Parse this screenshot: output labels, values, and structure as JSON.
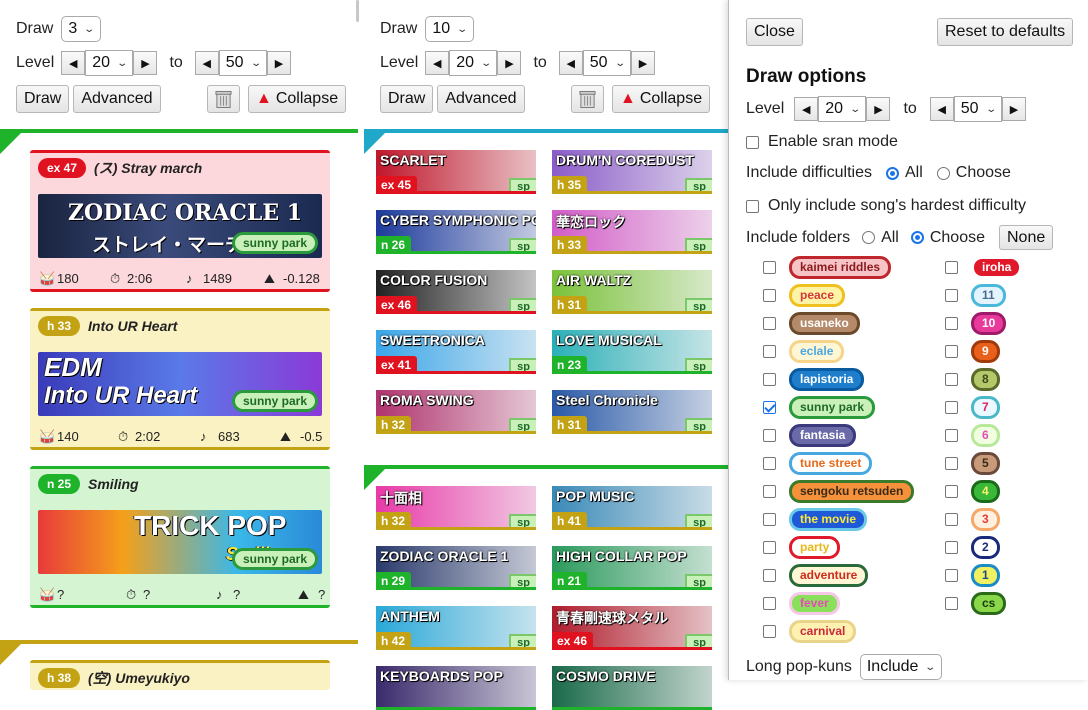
{
  "controls": {
    "draw_label": "Draw",
    "level_label": "Level",
    "to_label": "to",
    "draw_button": "Draw",
    "advanced_button": "Advanced",
    "collapse_button": "Collapse",
    "left_arrow": "◀",
    "right_arrow": "▶",
    "collapse_glyph": "▲"
  },
  "column1": {
    "draw_count": "3",
    "level_min": "20",
    "level_max": "50"
  },
  "column2": {
    "draw_count": "10",
    "level_min": "20",
    "level_max": "50"
  },
  "cards": [
    {
      "level": "ex 47",
      "title": "(ス) Stray march",
      "banner_line1": "ZODIAC ORACLE 1",
      "banner_line2": "ストレイ・マーチ",
      "folder": "sunny park",
      "bpm": "180",
      "time": "2:06",
      "notes": "1489",
      "tilt": "-0.128",
      "accent": "#e0121f",
      "bg": "#fcd8dc"
    },
    {
      "level": "h 33",
      "title": "Into UR Heart",
      "banner_line1": "EDM",
      "banner_line2": "Into UR Heart",
      "folder": "sunny park",
      "bpm": "140",
      "time": "2:02",
      "notes": "683",
      "tilt": "-0.5",
      "accent": "#c3a313",
      "bg": "#fbf2c4"
    },
    {
      "level": "n 25",
      "title": "Smiling",
      "banner_line1": "TRICK POP",
      "banner_line2": "Smiling",
      "folder": "sunny park",
      "bpm": "?",
      "time": "?",
      "notes": "?",
      "tilt": "?",
      "accent": "#1fb32b",
      "bg": "#d5f5d2"
    },
    {
      "level": "h 38",
      "title": "(空) Umeyukiyo",
      "accent": "#c3a313",
      "bg": "#fbf2c4"
    }
  ],
  "tiles_top": [
    {
      "title": "SCARLET",
      "level": "ex 45",
      "tag": "sp",
      "color": "#c0172b"
    },
    {
      "title": "DRUM'N COREDUST",
      "level": "h 35",
      "tag": "sp",
      "color": "#8b5cc8"
    },
    {
      "title": "CYBER SYMPHONIC POP",
      "level": "n 26",
      "tag": "sp",
      "color": "#1c3a9c"
    },
    {
      "title": "華恋ロック",
      "level": "h 33",
      "tag": "sp",
      "color": "#d25cc8"
    },
    {
      "title": "COLOR FUSION",
      "level": "ex 46",
      "tag": "sp",
      "color": "#222"
    },
    {
      "title": "AIR WALTZ",
      "level": "h 31",
      "tag": "sp",
      "color": "#7ac23a"
    },
    {
      "title": "SWEETRONICA",
      "level": "ex 41",
      "tag": "sp",
      "color": "#3aa6e8"
    },
    {
      "title": "LOVE MUSICAL",
      "level": "n 23",
      "tag": "sp",
      "color": "#2bb0b8"
    },
    {
      "title": "ROMA SWING",
      "level": "h 32",
      "tag": "sp",
      "color": "#b0336e"
    },
    {
      "title": "Steel Chronicle",
      "level": "h 31",
      "tag": "sp",
      "color": "#2a5aa8"
    }
  ],
  "tiles_bottom": [
    {
      "title": "十面相",
      "level": "h 32",
      "tag": "sp",
      "color": "#e83aa8"
    },
    {
      "title": "POP MUSIC",
      "level": "h 41",
      "tag": "sp",
      "color": "#3a8ab8"
    },
    {
      "title": "ZODIAC ORACLE 1",
      "level": "n 29",
      "tag": "sp",
      "color": "#2a3a6c"
    },
    {
      "title": "HIGH COLLAR POP",
      "level": "n 21",
      "tag": "sp",
      "color": "#2a9a5c"
    },
    {
      "title": "ANTHEM",
      "level": "h 42",
      "tag": "sp",
      "color": "#2aa8d8"
    },
    {
      "title": "青春剛速球メタル",
      "level": "ex 46",
      "tag": "sp",
      "color": "#b01c2c"
    },
    {
      "title": "KEYBOARDS POP",
      "level": "",
      "tag": "",
      "color": "#3a2a6c"
    },
    {
      "title": "COSMO DRIVE",
      "level": "",
      "tag": "",
      "color": "#1a6a4a"
    }
  ],
  "panel": {
    "close_button": "Close",
    "reset_button": "Reset to defaults",
    "title": "Draw options",
    "level_label": "Level",
    "level_min": "20",
    "level_max": "50",
    "to_label": "to",
    "sran_label": "Enable sran mode",
    "include_difficulties_label": "Include difficulties",
    "all_label": "All",
    "choose_label": "Choose",
    "hardest_label": "Only include song's hardest difficulty",
    "include_folders_label": "Include folders",
    "none_button": "None",
    "long_popkuns_label": "Long pop-kuns",
    "long_popkuns_value": "Include",
    "folders_left": [
      {
        "name": "kaimei riddles",
        "checked": false,
        "bg": "#f6c3c6",
        "border": "#c0272d",
        "fg": "#8a1a1e"
      },
      {
        "name": "peace",
        "checked": false,
        "bg": "#fff4a6",
        "border": "#f0c020",
        "fg": "#d03a3a"
      },
      {
        "name": "usaneko",
        "checked": false,
        "bg": "#b48a6a",
        "border": "#6a4a2a",
        "fg": "#fff"
      },
      {
        "name": "eclale",
        "checked": false,
        "bg": "#fff6d6",
        "border": "#f6d48a",
        "fg": "#4aa8e0"
      },
      {
        "name": "lapistoria",
        "checked": false,
        "bg": "#1e7ecb",
        "border": "#0a5aa0",
        "fg": "#fff"
      },
      {
        "name": "sunny park",
        "checked": true,
        "bg": "#c9f0b9",
        "border": "#2a9a3c",
        "fg": "#1d6b24"
      },
      {
        "name": "fantasia",
        "checked": false,
        "bg": "#6a6aa8",
        "border": "#3a3a7c",
        "fg": "#fff"
      },
      {
        "name": "tune street",
        "checked": false,
        "bg": "#fff",
        "border": "#4aa8e0",
        "fg": "#e86a1a"
      },
      {
        "name": "sengoku retsuden",
        "checked": false,
        "bg": "#f4913a",
        "border": "#3a7a2a",
        "fg": "#3a2a1a"
      },
      {
        "name": "the movie",
        "checked": false,
        "bg": "#1e5ad8",
        "border": "#6ac8e8",
        "fg": "#ffe83a"
      },
      {
        "name": "party",
        "checked": false,
        "bg": "#fff",
        "border": "#e01a2a",
        "fg": "#e8b81a"
      },
      {
        "name": "adventure",
        "checked": false,
        "bg": "#fff6d6",
        "border": "#2a6a3a",
        "fg": "#d02a1a"
      },
      {
        "name": "fever",
        "checked": false,
        "bg": "#8ae05a",
        "border": "#f6c8e8",
        "fg": "#e84ab8"
      },
      {
        "name": "carnival",
        "checked": false,
        "bg": "#fff2b0",
        "border": "#e8d48a",
        "fg": "#c8283a"
      }
    ],
    "folders_right": [
      {
        "name": "iroha",
        "checked": false,
        "bg": "#e01a2a",
        "border": "#fff",
        "fg": "#fff"
      },
      {
        "name": "11",
        "checked": false,
        "bg": "#e4f4ff",
        "border": "#4ab8d8",
        "fg": "#4a6a8a"
      },
      {
        "name": "10",
        "checked": false,
        "bg": "#e83a9a",
        "border": "#a01a6a",
        "fg": "#fff"
      },
      {
        "name": "9",
        "checked": false,
        "bg": "#e8601a",
        "border": "#a03a0a",
        "fg": "#fff"
      },
      {
        "name": "8",
        "checked": false,
        "bg": "#b4c86a",
        "border": "#5a6a2a",
        "fg": "#3a4a1a"
      },
      {
        "name": "7",
        "checked": false,
        "bg": "#eaf8ff",
        "border": "#4ab8c8",
        "fg": "#e0205a"
      },
      {
        "name": "6",
        "checked": false,
        "bg": "#f0ffe0",
        "border": "#b8e89a",
        "fg": "#e84ab8"
      },
      {
        "name": "5",
        "checked": false,
        "bg": "#c89a7a",
        "border": "#6a4a3a",
        "fg": "#3a2a1a"
      },
      {
        "name": "4",
        "checked": false,
        "bg": "#3ab83a",
        "border": "#1a6a1a",
        "fg": "#fff26a"
      },
      {
        "name": "3",
        "checked": false,
        "bg": "#fff0e0",
        "border": "#f4a86a",
        "fg": "#e83a3a"
      },
      {
        "name": "2",
        "checked": false,
        "bg": "#fff",
        "border": "#1a2a7a",
        "fg": "#1a2a7a"
      },
      {
        "name": "1",
        "checked": false,
        "bg": "#f0f060",
        "border": "#1a8ac8",
        "fg": "#1a4a8a"
      },
      {
        "name": "cs",
        "checked": false,
        "bg": "#8ad84a",
        "border": "#2a6a1a",
        "fg": "#1a3a0a"
      }
    ]
  },
  "icons": {
    "trash": "trash-icon",
    "bpm": "drum-icon",
    "time": "stopwatch-icon",
    "notes": "notes-icon",
    "tilt": "mountain-icon"
  }
}
